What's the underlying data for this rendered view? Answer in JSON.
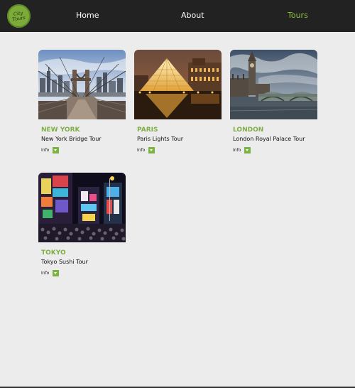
{
  "nav": {
    "logo_line1": "City",
    "logo_line2": "Tours",
    "links": [
      {
        "label": "Home",
        "active": false
      },
      {
        "label": "About",
        "active": false
      },
      {
        "label": "Tours",
        "active": true
      }
    ]
  },
  "colors": {
    "accent": "#8dc63f",
    "navbar": "#222222",
    "background": "#ececec",
    "city_title": "#7fae45"
  },
  "tours": [
    {
      "city": "NEW YORK",
      "name": "New York Bridge Tour",
      "info_label": "Info"
    },
    {
      "city": "PARIS",
      "name": "Paris Lights Tour",
      "info_label": "Info"
    },
    {
      "city": "LONDON",
      "name": "London Royal Palace Tour",
      "info_label": "Info"
    },
    {
      "city": "TOKYO",
      "name": "Tokyo Sushi Tour",
      "info_label": "Info"
    }
  ]
}
